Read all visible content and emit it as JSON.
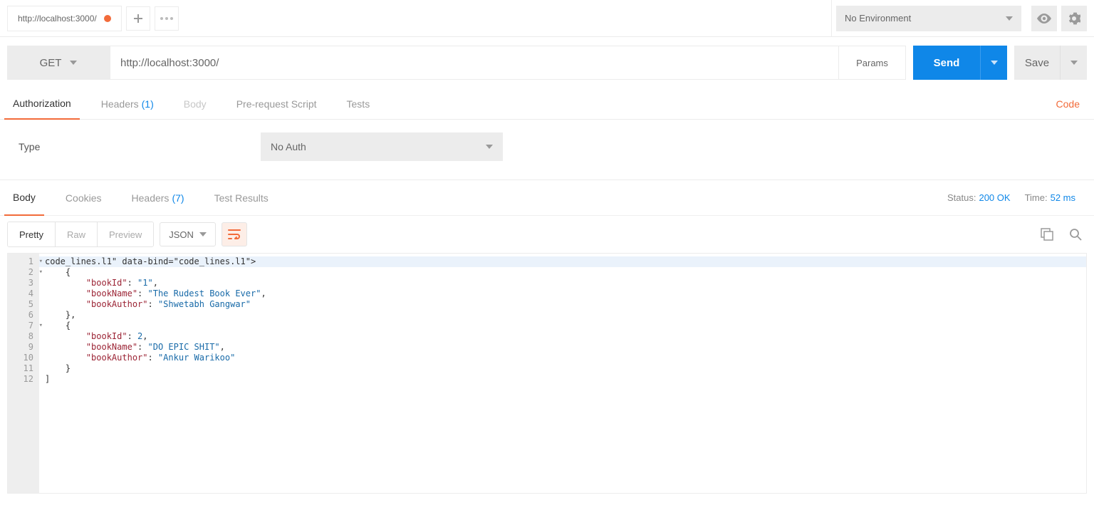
{
  "topbar": {
    "tab_title": "http://localhost:3000/",
    "environment": "No Environment"
  },
  "request": {
    "method": "GET",
    "url": "http://localhost:3000/",
    "params_label": "Params",
    "send_label": "Send",
    "save_label": "Save"
  },
  "req_tabs": {
    "authorization": "Authorization",
    "headers": "Headers",
    "headers_count": "(1)",
    "body": "Body",
    "prerequest": "Pre-request Script",
    "tests": "Tests",
    "code": "Code"
  },
  "auth": {
    "type_label": "Type",
    "selected": "No Auth"
  },
  "resp_tabs": {
    "body": "Body",
    "cookies": "Cookies",
    "headers": "Headers",
    "headers_count": "(7)",
    "test_results": "Test Results"
  },
  "status": {
    "status_label": "Status:",
    "status_value": "200 OK",
    "time_label": "Time:",
    "time_value": "52 ms"
  },
  "body_toolbar": {
    "pretty": "Pretty",
    "raw": "Raw",
    "preview": "Preview",
    "format": "JSON"
  },
  "response_body": [
    {
      "bookId": "1",
      "bookName": "The Rudest Book Ever",
      "bookAuthor": "Shwetabh Gangwar"
    },
    {
      "bookId": 2,
      "bookName": "DO EPIC SHIT",
      "bookAuthor": "Ankur Warikoo"
    }
  ],
  "code_lines": {
    "l1": "[",
    "l2": "    {",
    "l3_k1": "\"bookId\"",
    "l3_v1": "\"1\"",
    "l4_k1": "\"bookName\"",
    "l4_v1": "\"The Rudest Book Ever\"",
    "l5_k1": "\"bookAuthor\"",
    "l5_v1": "\"Shwetabh Gangwar\"",
    "l6": "    },",
    "l7": "    {",
    "l8_k1": "\"bookId\"",
    "l8_v1": "2",
    "l9_k1": "\"bookName\"",
    "l9_v1": "\"DO EPIC SHIT\"",
    "l10_k1": "\"bookAuthor\"",
    "l10_v1": "\"Ankur Warikoo\"",
    "l11": "    }",
    "l12": "]"
  },
  "line_numbers": [
    "1",
    "2",
    "3",
    "4",
    "5",
    "6",
    "7",
    "8",
    "9",
    "10",
    "11",
    "12"
  ]
}
